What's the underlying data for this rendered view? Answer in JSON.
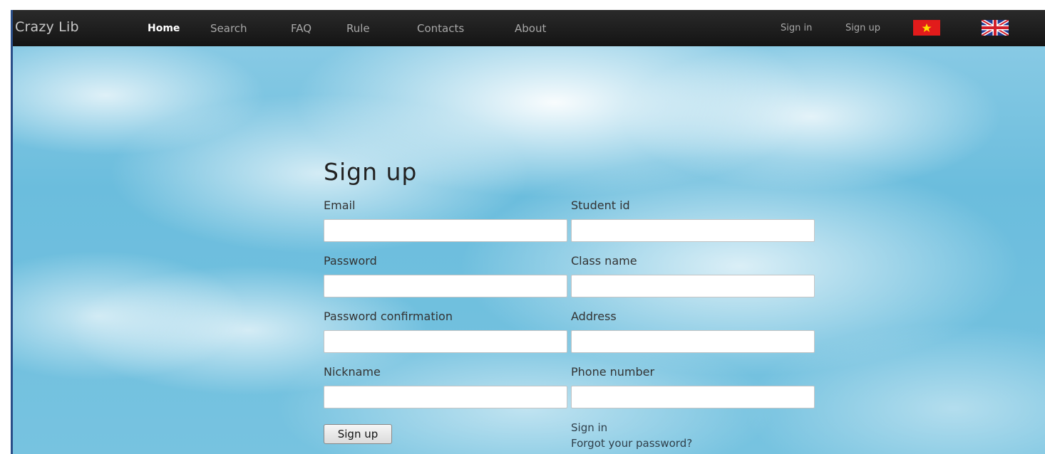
{
  "navbar": {
    "brand": "Crazy Lib",
    "links": [
      "Home",
      "Search",
      "FAQ",
      "Rule",
      "Contacts",
      "About"
    ],
    "active": "Home",
    "right_links": [
      "Sign in",
      "Sign up"
    ],
    "flags": [
      "vietnam-flag-icon",
      "uk-flag-icon"
    ]
  },
  "form": {
    "title": "Sign up",
    "left_fields": [
      {
        "label": "Email",
        "value": ""
      },
      {
        "label": "Password",
        "value": ""
      },
      {
        "label": "Password confirmation",
        "value": ""
      },
      {
        "label": "Nickname",
        "value": ""
      }
    ],
    "right_fields": [
      {
        "label": "Student id",
        "value": ""
      },
      {
        "label": "Class name",
        "value": ""
      },
      {
        "label": "Address",
        "value": ""
      },
      {
        "label": "Phone number",
        "value": ""
      }
    ],
    "submit_label": "Sign up",
    "signin_link": "Sign in",
    "forgot_link": "Forgot your password?"
  },
  "colors": {
    "navbar": "#1a1a1a",
    "sky": "#6bbddd",
    "active_link": "#ffffff"
  }
}
